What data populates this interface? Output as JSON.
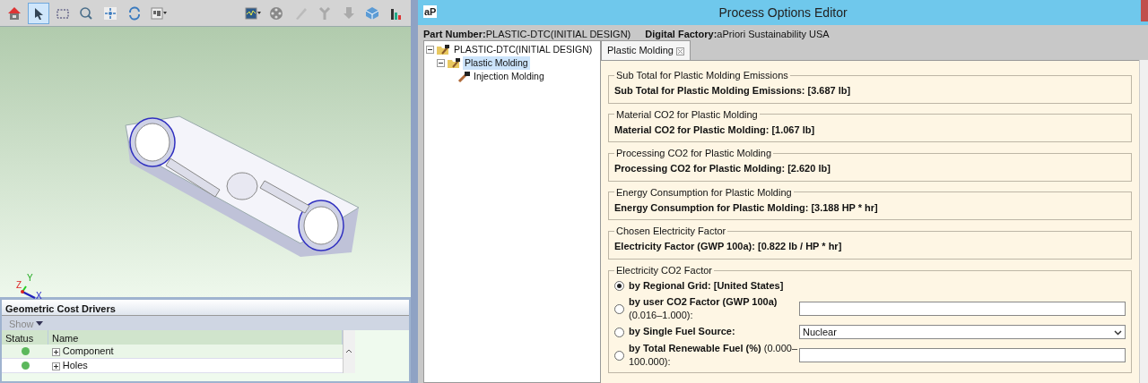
{
  "toolbar": {
    "left_tools": [
      {
        "kind": "home",
        "selected": false
      },
      {
        "kind": "pointer",
        "selected": true
      },
      {
        "kind": "rect",
        "selected": false
      },
      {
        "kind": "zoom",
        "selected": false
      },
      {
        "kind": "fit",
        "selected": false
      },
      {
        "kind": "rotate",
        "selected": false
      },
      {
        "kind": "layout",
        "selected": false
      }
    ],
    "right_tools": [
      {
        "kind": "image",
        "selected": false
      },
      {
        "kind": "sphere",
        "selected": false
      },
      {
        "kind": "pen",
        "selected": false
      },
      {
        "kind": "split",
        "selected": false
      },
      {
        "kind": "down",
        "selected": false
      },
      {
        "kind": "cube",
        "selected": false
      },
      {
        "kind": "bars",
        "selected": false
      }
    ]
  },
  "viewport": {
    "axes": [
      "Y",
      "Z",
      "X"
    ]
  },
  "cost_drivers": {
    "title": "Geometric Cost Drivers",
    "show_label": "Show",
    "columns": [
      "Status",
      "Name"
    ],
    "rows": [
      {
        "name": "Component",
        "color": "#5cb85c"
      },
      {
        "name": "Holes",
        "color": "#5cb85c"
      }
    ]
  },
  "dialog": {
    "logo": "aP",
    "title": "Process Options Editor",
    "part_number_label": "Part Number:",
    "part_number": "PLASTIC-DTC(INITIAL DESIGN)",
    "factory_label": "Digital Factory:",
    "factory": "aPriori Sustainability USA",
    "tree": [
      {
        "label": "PLASTIC-DTC(INITIAL DESIGN)",
        "selected": false,
        "expanded": true,
        "children": [
          {
            "label": "Plastic Molding",
            "selected": true,
            "expanded": true,
            "children": [
              {
                "label": "Injection Molding",
                "selected": false
              }
            ]
          }
        ]
      }
    ],
    "tabs": [
      {
        "label": "Plastic Molding",
        "selected": true
      }
    ],
    "groups": [
      {
        "legend": "Sub Total for Plastic Molding Emissions",
        "text": "Sub Total for Plastic Molding Emissions: [3.687 lb]"
      },
      {
        "legend": "Material CO2 for Plastic Molding",
        "text": "Material CO2 for Plastic Molding: [1.067 lb]"
      },
      {
        "legend": "Processing CO2 for Plastic Molding",
        "text": "Processing CO2 for Plastic Molding: [2.620 lb]"
      },
      {
        "legend": "Energy Consumption for Plastic Molding",
        "text": "Energy Consumption for Plastic Molding: [3.188 HP * hr]"
      },
      {
        "legend": "Chosen Electricity Factor",
        "text": "Electricity Factor (GWP 100a): [0.822 lb / HP * hr]"
      }
    ],
    "electricity": {
      "legend": "Electricity CO2 Factor",
      "options": [
        {
          "kind": "none",
          "label": "**by Regional Grid: [United States]**",
          "selected": true
        },
        {
          "kind": "input",
          "label": "**by user CO2 Factor (GWP 100a)** (0.016–1.000):",
          "selected": false
        },
        {
          "kind": "select",
          "label": "**by Single Fuel Source:**",
          "value": "Nuclear",
          "selected": false
        },
        {
          "kind": "input",
          "label": "**by Total Renewable Fuel (%)** (0.000–100.000):",
          "selected": false
        }
      ]
    }
  }
}
